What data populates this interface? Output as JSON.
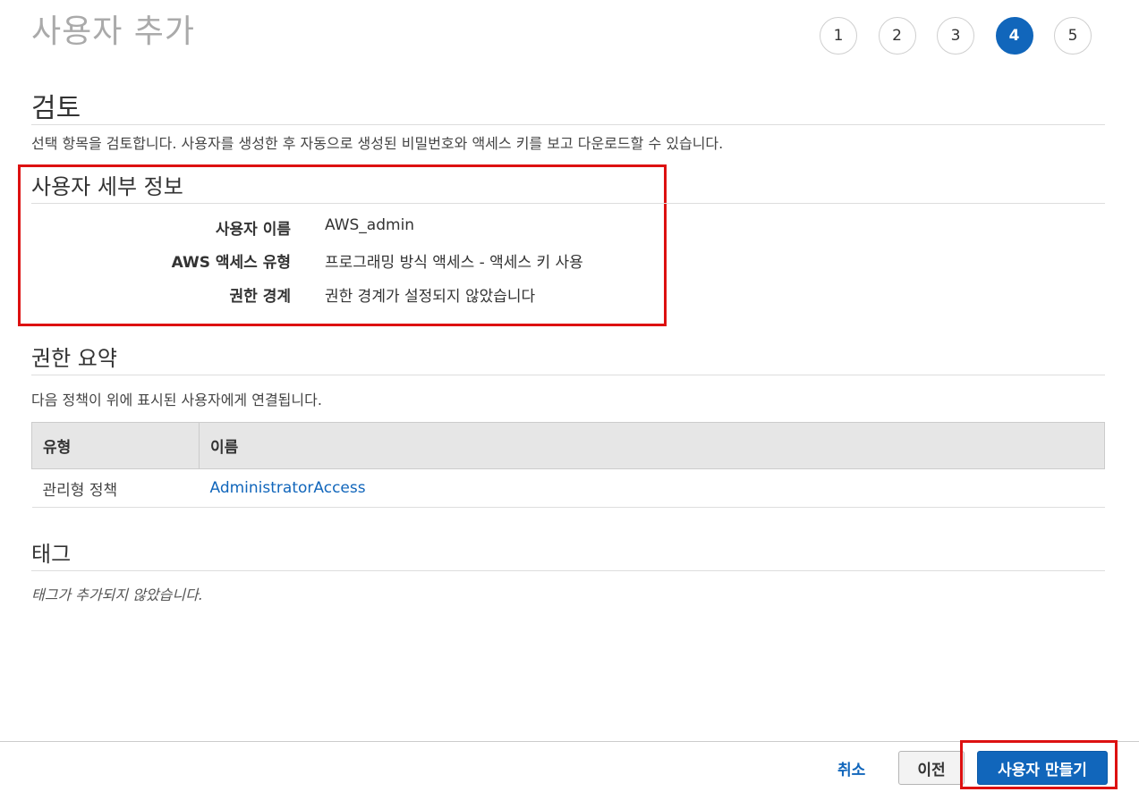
{
  "page": {
    "title": "사용자 추가"
  },
  "steps": [
    "1",
    "2",
    "3",
    "4",
    "5"
  ],
  "active_step": "4",
  "review": {
    "heading": "검토",
    "description": "선택 항목을 검토합니다. 사용자를 생성한 후 자동으로 생성된 비밀번호와 액세스 키를 보고 다운로드할 수 있습니다."
  },
  "user_details": {
    "heading": "사용자 세부 정보",
    "rows": [
      {
        "label": "사용자 이름",
        "value": "AWS_admin"
      },
      {
        "label": "AWS 액세스 유형",
        "value": "프로그래밍 방식 액세스 - 액세스 키 사용"
      },
      {
        "label": "권한 경계",
        "value": "권한 경계가 설정되지 않았습니다"
      }
    ]
  },
  "permissions": {
    "heading": "권한 요약",
    "description": "다음 정책이 위에 표시된 사용자에게 연결됩니다.",
    "columns": [
      "유형",
      "이름"
    ],
    "rows": [
      {
        "type": "관리형 정책",
        "name": "AdministratorAccess"
      }
    ]
  },
  "tags": {
    "heading": "태그",
    "empty_text": "태그가 추가되지 않았습니다."
  },
  "footer": {
    "cancel": "취소",
    "previous": "이전",
    "create": "사용자 만들기"
  },
  "colors": {
    "accent": "#1166bb",
    "highlight_border": "#dd1111"
  }
}
